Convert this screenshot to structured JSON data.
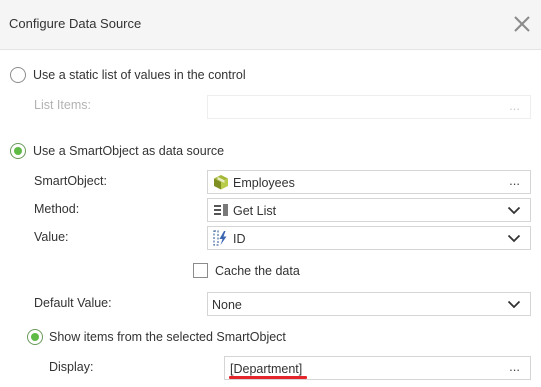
{
  "dialog": {
    "title": "Configure Data Source"
  },
  "static_list": {
    "option_label": "Use a static list of values in the control",
    "list_items_label": "List Items:",
    "list_items_value": "",
    "selected": false
  },
  "smartobject_source": {
    "option_label": "Use a SmartObject as data source",
    "selected": true,
    "smartobject_label": "SmartObject:",
    "smartobject_value": "Employees",
    "method_label": "Method:",
    "method_value": "Get List",
    "value_label": "Value:",
    "value_value": "ID",
    "cache_label": "Cache the data",
    "cache_checked": false,
    "default_label": "Default Value:",
    "default_value": "None",
    "show_items_label": "Show items from the selected SmartObject",
    "show_items_selected": true,
    "display_label": "Display:",
    "display_value": "[Department]"
  },
  "ellipsis": "...",
  "colors": {
    "radio_selected": "#5fba46",
    "underline": "#e4262c",
    "header_bg": "#f5f5f5"
  },
  "icons": {
    "close": "close-icon",
    "smartobject": "smartobject-cube-icon",
    "method": "list-method-icon",
    "value": "property-field-icon",
    "dropdown": "chevron-down-icon"
  }
}
